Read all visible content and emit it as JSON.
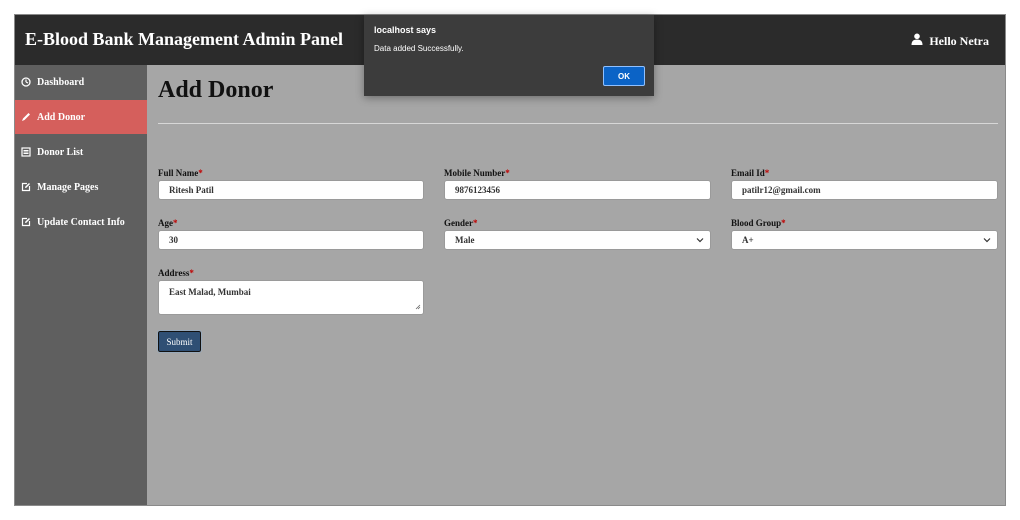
{
  "header": {
    "title": "E-Blood Bank Management Admin Panel",
    "user_greeting": "Hello Netra"
  },
  "sidebar": {
    "items": [
      {
        "label": "Dashboard",
        "icon": "dashboard-icon"
      },
      {
        "label": "Add Donor",
        "icon": "pencil-icon",
        "active": true
      },
      {
        "label": "Donor List",
        "icon": "list-icon"
      },
      {
        "label": "Manage Pages",
        "icon": "edit-icon"
      },
      {
        "label": "Update Contact Info",
        "icon": "edit-icon"
      }
    ]
  },
  "main": {
    "page_title": "Add Donor",
    "form": {
      "full_name": {
        "label": "Full Name",
        "required_mark": "*",
        "value": "Ritesh Patil"
      },
      "mobile": {
        "label": "Mobile Number",
        "required_mark": "*",
        "value": "9876123456"
      },
      "email": {
        "label": "Email Id",
        "required_mark": "*",
        "value": "patilr12@gmail.com"
      },
      "age": {
        "label": "Age",
        "required_mark": "*",
        "value": "30"
      },
      "gender": {
        "label": "Gender",
        "required_mark": "*",
        "value": "Male"
      },
      "blood_group": {
        "label": "Blood Group",
        "required_mark": "*",
        "value": "A+"
      },
      "address": {
        "label": "Address",
        "required_mark": "*",
        "value": "East Malad, Mumbai"
      },
      "submit_label": "Submit"
    }
  },
  "dialog": {
    "title": "localhost says",
    "message": "Data added Successfully.",
    "ok_label": "OK"
  },
  "colors": {
    "topbar": "#2b2b2b",
    "sidebar": "#5f5f5f",
    "active": "#d55f5c",
    "main": "#a6a6a6",
    "submit": "#2f4f74",
    "dialog_ok": "#0b63c6"
  }
}
